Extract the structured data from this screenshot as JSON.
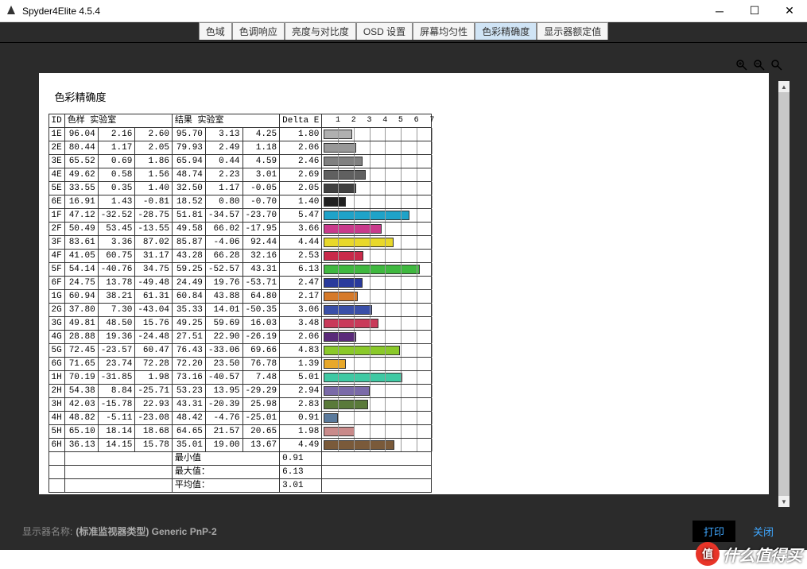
{
  "window": {
    "title": "Spyder4Elite 4.5.4"
  },
  "tabs": [
    "色域",
    "色调响应",
    "亮度与对比度",
    "OSD 设置",
    "屏幕均匀性",
    "色彩精确度",
    "显示器额定值"
  ],
  "active_tab": 5,
  "page": {
    "title": "色彩精确度",
    "headers": {
      "id": "ID",
      "sample": "色样 实验室",
      "result": "结果 实验室",
      "delta": "Delta E"
    },
    "axis_ticks": [
      1,
      2,
      3,
      4,
      5,
      6,
      7
    ],
    "summary": {
      "min_label": "最小值",
      "min": 0.91,
      "max_label": "最大值：",
      "max": 6.13,
      "avg_label": "平均值：",
      "avg": 3.01
    }
  },
  "chart_data": {
    "type": "bar",
    "xlabel": "",
    "ylabel": "Delta E",
    "xlim": [
      0,
      7
    ],
    "rows": [
      {
        "id": "1E",
        "s1": 96.04,
        "s2": 2.16,
        "s3": 2.6,
        "r1": 95.7,
        "r2": 3.13,
        "r3": 4.25,
        "de": 1.8,
        "color": "#b0b0b0"
      },
      {
        "id": "2E",
        "s1": 80.44,
        "s2": 1.17,
        "s3": 2.05,
        "r1": 79.93,
        "r2": 2.49,
        "r3": 1.18,
        "de": 2.06,
        "color": "#989898"
      },
      {
        "id": "3E",
        "s1": 65.52,
        "s2": 0.69,
        "s3": 1.86,
        "r1": 65.94,
        "r2": 0.44,
        "r3": 4.59,
        "de": 2.46,
        "color": "#808080"
      },
      {
        "id": "4E",
        "s1": 49.62,
        "s2": 0.58,
        "s3": 1.56,
        "r1": 48.74,
        "r2": 2.23,
        "r3": 3.01,
        "de": 2.69,
        "color": "#606060"
      },
      {
        "id": "5E",
        "s1": 33.55,
        "s2": 0.35,
        "s3": 1.4,
        "r1": 32.5,
        "r2": 1.17,
        "r3": -0.05,
        "de": 2.05,
        "color": "#404040"
      },
      {
        "id": "6E",
        "s1": 16.91,
        "s2": 1.43,
        "s3": -0.81,
        "r1": 18.52,
        "r2": 0.8,
        "r3": -0.7,
        "de": 1.4,
        "color": "#202020"
      },
      {
        "id": "1F",
        "s1": 47.12,
        "s2": -32.52,
        "s3": -28.75,
        "r1": 51.81,
        "r2": -34.57,
        "r3": -23.7,
        "de": 5.47,
        "color": "#1fa3c9"
      },
      {
        "id": "2F",
        "s1": 50.49,
        "s2": 53.45,
        "s3": -13.55,
        "r1": 49.58,
        "r2": 66.02,
        "r3": -17.95,
        "de": 3.66,
        "color": "#c93a8c"
      },
      {
        "id": "3F",
        "s1": 83.61,
        "s2": 3.36,
        "s3": 87.02,
        "r1": 85.87,
        "r2": -4.06,
        "r3": 92.44,
        "de": 4.44,
        "color": "#e8d82a"
      },
      {
        "id": "4F",
        "s1": 41.05,
        "s2": 60.75,
        "s3": 31.17,
        "r1": 43.28,
        "r2": 66.28,
        "r3": 32.16,
        "de": 2.53,
        "color": "#c92a4a"
      },
      {
        "id": "5F",
        "s1": 54.14,
        "s2": -40.76,
        "s3": 34.75,
        "r1": 59.25,
        "r2": -52.57,
        "r3": 43.31,
        "de": 6.13,
        "color": "#3fb83f"
      },
      {
        "id": "6F",
        "s1": 24.75,
        "s2": 13.78,
        "s3": -49.48,
        "r1": 24.49,
        "r2": 19.76,
        "r3": -53.71,
        "de": 2.47,
        "color": "#2a3a9c"
      },
      {
        "id": "1G",
        "s1": 60.94,
        "s2": 38.21,
        "s3": 61.31,
        "r1": 60.84,
        "r2": 43.88,
        "r3": 64.8,
        "de": 2.17,
        "color": "#d67a2a"
      },
      {
        "id": "2G",
        "s1": 37.8,
        "s2": 7.3,
        "s3": -43.04,
        "r1": 35.33,
        "r2": 14.01,
        "r3": -50.35,
        "de": 3.06,
        "color": "#3a4fa8"
      },
      {
        "id": "3G",
        "s1": 49.81,
        "s2": 48.5,
        "s3": 15.76,
        "r1": 49.25,
        "r2": 59.69,
        "r3": 16.03,
        "de": 3.48,
        "color": "#c93a5a"
      },
      {
        "id": "4G",
        "s1": 28.88,
        "s2": 19.36,
        "s3": -24.48,
        "r1": 27.51,
        "r2": 22.9,
        "r3": -26.19,
        "de": 2.06,
        "color": "#5a2a7a"
      },
      {
        "id": "5G",
        "s1": 72.45,
        "s2": -23.57,
        "s3": 60.47,
        "r1": 76.43,
        "r2": -33.06,
        "r3": 69.66,
        "de": 4.83,
        "color": "#8ac92a"
      },
      {
        "id": "6G",
        "s1": 71.65,
        "s2": 23.74,
        "s3": 72.28,
        "r1": 72.2,
        "r2": 23.5,
        "r3": 76.78,
        "de": 1.39,
        "color": "#e8a82a"
      },
      {
        "id": "1H",
        "s1": 70.19,
        "s2": -31.85,
        "s3": 1.98,
        "r1": 73.16,
        "r2": -40.57,
        "r3": 7.48,
        "de": 5.01,
        "color": "#3fc9a3"
      },
      {
        "id": "2H",
        "s1": 54.38,
        "s2": 8.84,
        "s3": -25.71,
        "r1": 53.23,
        "r2": 13.95,
        "r3": -29.29,
        "de": 2.94,
        "color": "#7a6aa8"
      },
      {
        "id": "3H",
        "s1": 42.03,
        "s2": -15.78,
        "s3": 22.93,
        "r1": 43.31,
        "r2": -20.39,
        "r3": 25.98,
        "de": 2.83,
        "color": "#5a7a3a"
      },
      {
        "id": "4H",
        "s1": 48.82,
        "s2": -5.11,
        "s3": -23.08,
        "r1": 48.42,
        "r2": -4.76,
        "r3": -25.01,
        "de": 0.91,
        "color": "#5a7a9c"
      },
      {
        "id": "5H",
        "s1": 65.1,
        "s2": 18.14,
        "s3": 18.68,
        "r1": 64.65,
        "r2": 21.57,
        "r3": 20.65,
        "de": 1.98,
        "color": "#c98a8a"
      },
      {
        "id": "6H",
        "s1": 36.13,
        "s2": 14.15,
        "s3": 15.78,
        "r1": 35.01,
        "r2": 19.0,
        "r3": 13.67,
        "de": 4.49,
        "color": "#7a5a3a"
      }
    ]
  },
  "footer": {
    "label": "显示器名称:",
    "value": "(标准监视器类型) Generic PnP-2",
    "print": "打印",
    "close": "关闭"
  },
  "watermark": "什么值得买",
  "watermark_badge": "值"
}
